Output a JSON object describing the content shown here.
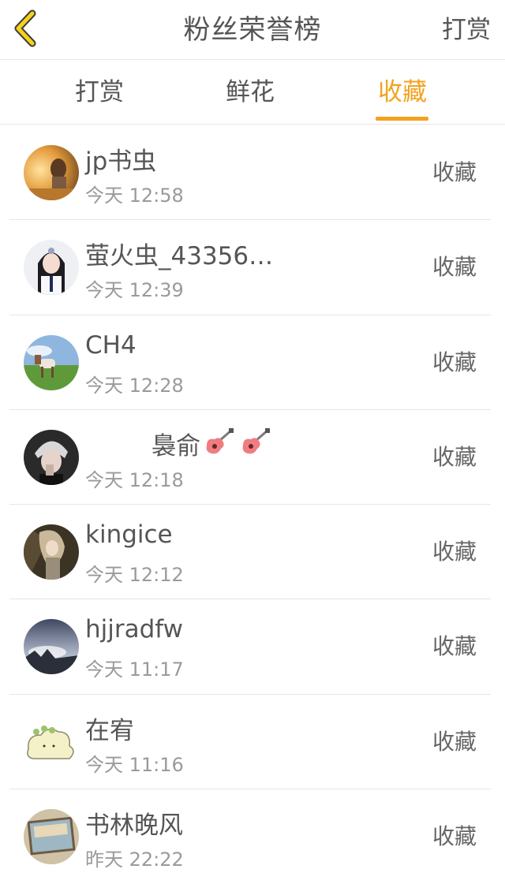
{
  "header": {
    "back_icon": "chevron-left-icon",
    "title": "粉丝荣誉榜",
    "right_action": "打赏",
    "accent_color": "#f3a21f"
  },
  "tabs": [
    {
      "label": "打赏",
      "active": false
    },
    {
      "label": "鲜花",
      "active": false
    },
    {
      "label": "收藏",
      "active": true
    }
  ],
  "fans": [
    {
      "name": "jp书虫",
      "time": "今天 12:58",
      "action": "收藏"
    },
    {
      "name": "萤火虫_43356…",
      "time": "今天 12:39",
      "action": "收藏"
    },
    {
      "name": "CH4",
      "time": "今天 12:28",
      "action": "收藏"
    },
    {
      "name": "裊俞",
      "time": "今天 12:18",
      "action": "收藏",
      "decor": "guitar-emoji-icon"
    },
    {
      "name": "kingice",
      "time": "今天 12:12",
      "action": "收藏"
    },
    {
      "name": "hjjradfw",
      "time": "今天 11:17",
      "action": "收藏"
    },
    {
      "name": "在宥",
      "time": "今天 11:16",
      "action": "收藏"
    },
    {
      "name": "书林晚风",
      "time": "昨天 22:22",
      "action": "收藏"
    }
  ]
}
